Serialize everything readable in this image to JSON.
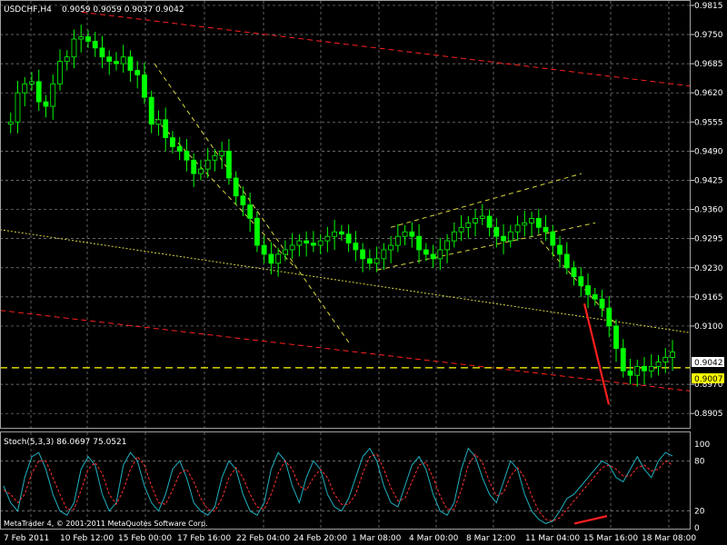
{
  "header": {
    "symbol": "USDCHF,H4",
    "ohlc": "0.9059 0.9059 0.9037 0.9042"
  },
  "indicator": {
    "label": "Stoch(5,3,3) 86.0697 75.0521"
  },
  "footer": {
    "copyright": "MetaTrader 4, © 2001-2011 MetaQuotes Software Corp."
  },
  "colors": {
    "background": "#000000",
    "grid": "#8a8a8a",
    "candle": "#00ff00",
    "trend_red": "#ff2020",
    "channel_yellow": "#d8d840",
    "stoch_main": "#20b0c0",
    "stoch_signal": "#ff3030",
    "current_price_bg": "#ffffff",
    "level_price_bg": "#ffff00"
  },
  "chart_data": [
    {
      "type": "candlestick",
      "title": "USDCHF,H4",
      "ylim": [
        0.8873,
        0.9825
      ],
      "y_ticks": [
        "0.9815",
        "0.9750",
        "0.9685",
        "0.9620",
        "0.9555",
        "0.9490",
        "0.9425",
        "0.9360",
        "0.9295",
        "0.9230",
        "0.9165",
        "0.9100",
        "0.8970",
        "0.8905"
      ],
      "x_ticks": [
        "7 Feb 2011",
        "10 Feb 12:00",
        "15 Feb 00:00",
        "17 Feb 16:00",
        "22 Feb 04:00",
        "24 Feb 20:00",
        "1 Mar 08:00",
        "4 Mar 00:00",
        "8 Mar 12:00",
        "11 Mar 04:00",
        "15 Mar 16:00",
        "18 Mar 08:00"
      ],
      "current_price": "0.9042",
      "level_price": "0.9007",
      "close_path": [
        0.955,
        0.9555,
        0.962,
        0.964,
        0.9645,
        0.96,
        0.959,
        0.964,
        0.969,
        0.97,
        0.974,
        0.9745,
        0.9735,
        0.972,
        0.97,
        0.969,
        0.9685,
        0.97,
        0.967,
        0.966,
        0.961,
        0.955,
        0.956,
        0.952,
        0.95,
        0.949,
        0.947,
        0.944,
        0.945,
        0.947,
        0.948,
        0.949,
        0.943,
        0.939,
        0.937,
        0.934,
        0.928,
        0.926,
        0.924,
        0.926,
        0.927,
        0.928,
        0.929,
        0.9285,
        0.928,
        0.929,
        0.93,
        0.931,
        0.9305,
        0.9285,
        0.927,
        0.925,
        0.924,
        0.925,
        0.927,
        0.928,
        0.93,
        0.931,
        0.93,
        0.927,
        0.926,
        0.925,
        0.927,
        0.929,
        0.931,
        0.932,
        0.933,
        0.934,
        0.9345,
        0.932,
        0.93,
        0.929,
        0.931,
        0.9325,
        0.933,
        0.934,
        0.932,
        0.931,
        0.928,
        0.926,
        0.923,
        0.921,
        0.919,
        0.917,
        0.916,
        0.914,
        0.91,
        0.905,
        0.9,
        0.899,
        0.901,
        0.9,
        0.901,
        0.902,
        0.903,
        0.9042
      ]
    },
    {
      "type": "line",
      "title": "Stoch(5,3,3) 86.0697 75.0521",
      "ylim": [
        0,
        100
      ],
      "y_ticks": [
        "100",
        "80",
        "20",
        "0"
      ],
      "series": [
        {
          "name": "",
          "values": [
            50,
            30,
            20,
            60,
            85,
            90,
            70,
            40,
            20,
            15,
            30,
            70,
            85,
            75,
            40,
            20,
            30,
            75,
            90,
            80,
            50,
            30,
            20,
            40,
            70,
            80,
            60,
            30,
            20,
            15,
            25,
            60,
            80,
            70,
            40,
            20,
            15,
            30,
            70,
            90,
            80,
            50,
            30,
            60,
            80,
            70,
            40,
            25,
            20,
            35,
            60,
            85,
            95,
            80,
            50,
            30,
            25,
            50,
            75,
            85,
            70,
            40,
            20,
            15,
            30,
            70,
            95,
            85,
            60,
            40,
            30,
            55,
            80,
            70,
            40,
            20,
            10,
            5,
            8,
            20,
            35,
            40,
            50,
            60,
            70,
            80,
            75,
            60,
            55,
            70,
            85,
            70,
            60,
            80,
            90,
            86
          ]
        },
        {
          "name": "",
          "values": [
            45,
            40,
            30,
            40,
            65,
            80,
            80,
            60,
            40,
            22,
            22,
            45,
            70,
            78,
            65,
            40,
            28,
            45,
            70,
            85,
            75,
            50,
            30,
            28,
            45,
            65,
            70,
            55,
            35,
            22,
            20,
            35,
            60,
            72,
            60,
            40,
            25,
            22,
            40,
            65,
            80,
            70,
            50,
            45,
            60,
            70,
            60,
            40,
            28,
            28,
            40,
            65,
            85,
            88,
            70,
            48,
            32,
            35,
            55,
            75,
            78,
            60,
            38,
            22,
            22,
            45,
            75,
            88,
            78,
            55,
            38,
            42,
            62,
            72,
            60,
            38,
            20,
            10,
            8,
            12,
            22,
            32,
            42,
            52,
            62,
            72,
            75,
            70,
            62,
            62,
            72,
            75,
            68,
            70,
            80,
            75
          ]
        }
      ]
    }
  ]
}
